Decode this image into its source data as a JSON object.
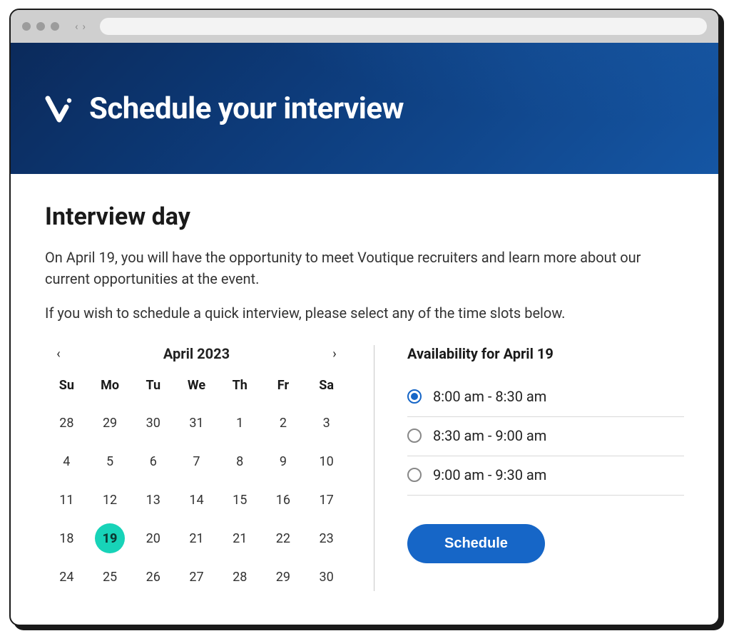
{
  "hero": {
    "title": "Schedule your interview",
    "logo_name": "v-logo"
  },
  "section": {
    "heading": "Interview day",
    "paragraph1": "On April 19, you will have the opportunity to meet Voutique recruiters and learn more about our current opportunities at the event.",
    "paragraph2": "If you wish to schedule a quick interview, please select any of the time slots below."
  },
  "calendar": {
    "month_label": "April 2023",
    "day_headers": [
      "Su",
      "Mo",
      "Tu",
      "We",
      "Th",
      "Fr",
      "Sa"
    ],
    "weeks": [
      [
        28,
        29,
        30,
        31,
        1,
        2,
        3
      ],
      [
        4,
        5,
        6,
        7,
        8,
        9,
        10
      ],
      [
        11,
        12,
        13,
        14,
        15,
        16,
        17
      ],
      [
        18,
        19,
        20,
        21,
        21,
        22,
        23
      ],
      [
        24,
        25,
        26,
        27,
        28,
        29,
        30
      ]
    ],
    "selected_day": 19,
    "prev_icon": "‹",
    "next_icon": "›"
  },
  "availability": {
    "title": "Availability for April 19",
    "slots": [
      {
        "label": "8:00 am - 8:30 am",
        "selected": true
      },
      {
        "label": "8:30 am - 9:00 am",
        "selected": false
      },
      {
        "label": "9:00 am - 9:30 am",
        "selected": false
      }
    ],
    "button_label": "Schedule"
  },
  "colors": {
    "accent_teal": "#17d3b8",
    "primary_blue": "#1666c7",
    "hero_gradient_from": "#0b2a5b",
    "hero_gradient_to": "#1556a4"
  }
}
